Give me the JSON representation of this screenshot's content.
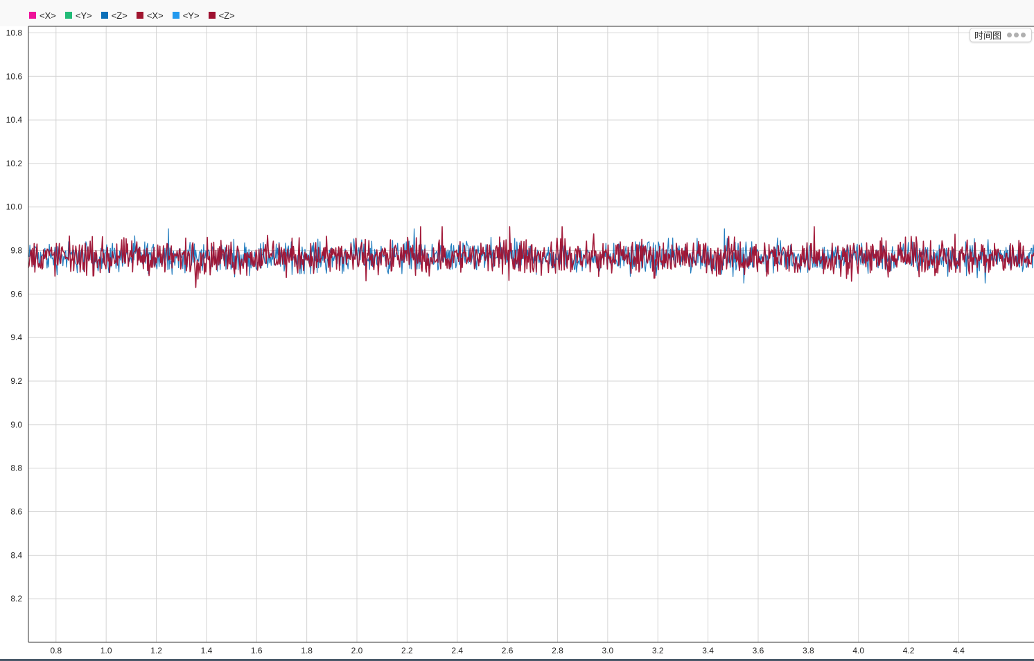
{
  "legend": [
    {
      "label": "<X>",
      "color": "#ee1199"
    },
    {
      "label": "<Y>",
      "color": "#22bb77"
    },
    {
      "label": "<Z>",
      "color": "#0b6fb8"
    },
    {
      "label": "<X>",
      "color": "#a0152f"
    },
    {
      "label": "<Y>",
      "color": "#2299ee"
    },
    {
      "label": "<Z>",
      "color": "#9e1030"
    }
  ],
  "badge": {
    "label": "时间图",
    "icon": "more-dots-icon"
  },
  "chart_data": {
    "type": "line",
    "xlim": [
      0.69,
      4.7
    ],
    "ylim": [
      8.0,
      10.83
    ],
    "x_ticks": [
      0.8,
      1.0,
      1.2,
      1.4,
      1.6,
      1.8,
      2.0,
      2.2,
      2.4,
      2.6,
      2.8,
      3.0,
      3.2,
      3.4,
      3.6,
      3.8,
      4.0,
      4.2,
      4.4
    ],
    "x_tick_labels": [
      "0.8",
      "1.0",
      "1.2",
      "1.4",
      "1.6",
      "1.8",
      "2.0",
      "2.2",
      "2.4",
      "2.6",
      "2.8",
      "3.0",
      "3.2",
      "3.4",
      "3.6",
      "3.8",
      "4.0",
      "4.2",
      "4.4"
    ],
    "y_ticks": [
      8.2,
      8.4,
      8.6,
      8.8,
      9.0,
      9.2,
      9.4,
      9.6,
      9.8,
      10.0,
      10.2,
      10.4,
      10.6,
      10.8
    ],
    "y_tick_labels": [
      "8.2",
      "8.4",
      "8.6",
      "8.8",
      "9.0",
      "9.2",
      "9.4",
      "9.6",
      "9.8",
      "10.0",
      "10.2",
      "10.4",
      "10.6",
      "10.8"
    ],
    "grid": true,
    "legend_position": "top-left",
    "series": [
      {
        "name": "<Z>",
        "color": "#0b6fb8",
        "mean": 9.77,
        "min": 9.65,
        "max": 9.9,
        "x_range": [
          0.69,
          4.7
        ]
      },
      {
        "name": "<Z>",
        "color": "#9e1030",
        "mean": 9.77,
        "min": 9.63,
        "max": 9.91,
        "x_range": [
          0.69,
          4.7
        ]
      }
    ]
  }
}
